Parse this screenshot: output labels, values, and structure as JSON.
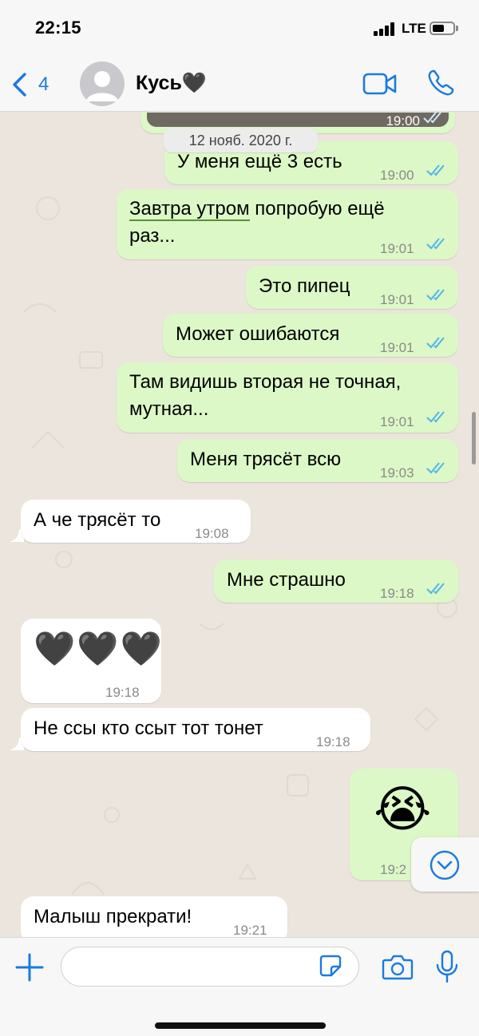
{
  "status_bar": {
    "time": "22:15",
    "network": "LTE",
    "battery_level": 0.6
  },
  "header": {
    "back_count": "4",
    "contact_name": "Кусь🖤",
    "back_icon": "chevron-left-icon",
    "video_icon": "video-camera-icon",
    "phone_icon": "phone-icon",
    "accent_color": "#1a7ae0"
  },
  "chat": {
    "date_separator": "12 нояб. 2020 г.",
    "top_partial_time": "19:00",
    "messages": [
      {
        "dir": "out",
        "text": "У меня ещё 3 есть",
        "time": "19:00",
        "read": true
      },
      {
        "dir": "out",
        "text_underlined": "Завтра утром",
        "text_rest": " попробую ещё",
        "text_line2": "раз...",
        "time": "19:01",
        "read": true
      },
      {
        "dir": "out",
        "text": "Это пипец",
        "time": "19:01",
        "read": true
      },
      {
        "dir": "out",
        "text": "Может ошибаются",
        "time": "19:01",
        "read": true
      },
      {
        "dir": "out",
        "text": "Там видишь вторая не точная,",
        "text_line2": "мутная...",
        "time": "19:01",
        "read": true
      },
      {
        "dir": "out",
        "text": "Меня трясёт всю",
        "time": "19:03",
        "read": true
      },
      {
        "dir": "in",
        "text": "А че трясёт то",
        "time": "19:08"
      },
      {
        "dir": "out",
        "text": "Мне страшно",
        "time": "19:18",
        "read": true
      },
      {
        "dir": "in",
        "emoji": "🖤🖤🖤",
        "time": "19:18"
      },
      {
        "dir": "in",
        "text": "Не ссы кто ссыт тот тонет",
        "time": "19:18"
      },
      {
        "dir": "out",
        "emoji": "😭",
        "time": "19:2",
        "read": true
      },
      {
        "dir": "in",
        "text": "Малыш прекрати!",
        "time": "19:21"
      }
    ],
    "colors": {
      "outgoing_bubble": "#dcf8c6",
      "incoming_bubble": "#ffffff",
      "read_ticks": "#4fb6ec",
      "background": "#ece5dd"
    },
    "scroll_down_icon": "chevron-down-circle-icon"
  },
  "input_bar": {
    "placeholder": "",
    "plus_icon": "plus-icon",
    "sticker_icon": "sticker-icon",
    "camera_icon": "camera-icon",
    "mic_icon": "microphone-icon"
  }
}
